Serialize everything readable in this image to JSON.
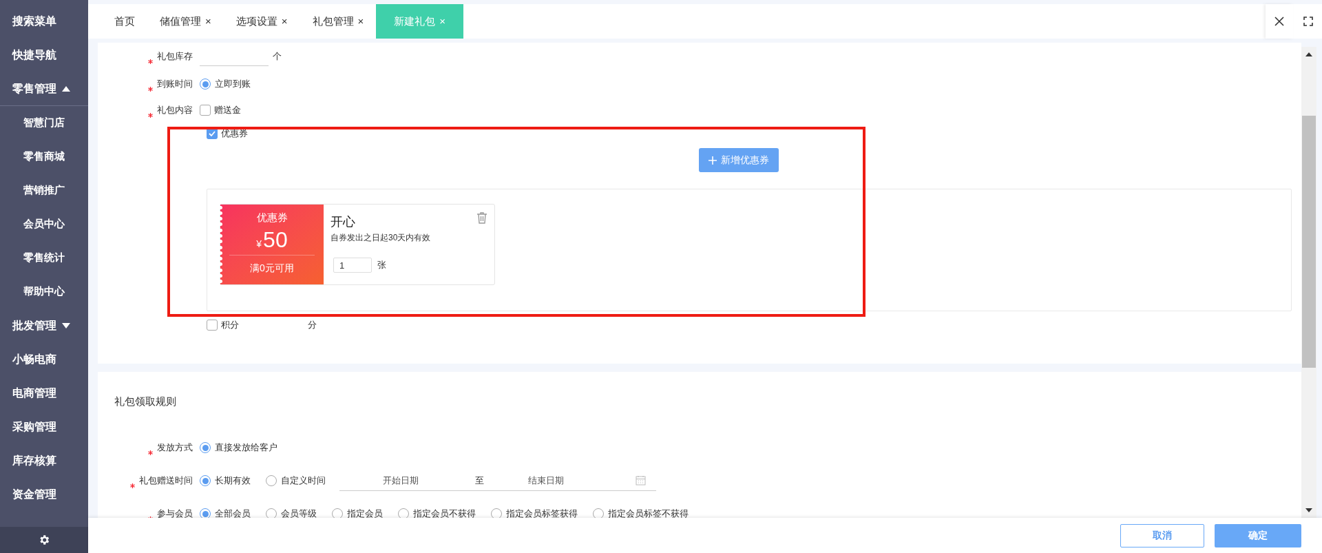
{
  "sidebar": {
    "items": [
      {
        "label": "搜索菜单"
      },
      {
        "label": "快捷导航"
      },
      {
        "label": "零售管理",
        "expanded": true,
        "children": [
          {
            "label": "智慧门店"
          },
          {
            "label": "零售商城"
          },
          {
            "label": "营销推广"
          },
          {
            "label": "会员中心"
          },
          {
            "label": "零售统计"
          },
          {
            "label": "帮助中心"
          }
        ]
      },
      {
        "label": "批发管理",
        "expanded": false
      },
      {
        "label": "小畅电商"
      },
      {
        "label": "电商管理"
      },
      {
        "label": "采购管理"
      },
      {
        "label": "库存核算"
      },
      {
        "label": "资金管理"
      }
    ]
  },
  "tabs": [
    {
      "label": "首页",
      "selected": false
    },
    {
      "label": "储值管理",
      "close": "×",
      "selected": false
    },
    {
      "label": "选项设置",
      "close": "×",
      "selected": false
    },
    {
      "label": "礼包管理",
      "close": "×",
      "selected": false
    },
    {
      "label": "新建礼包",
      "close": "×",
      "selected": true
    }
  ],
  "gift_form": {
    "stock": {
      "label": "礼包库存",
      "required": true,
      "unit": "个"
    },
    "arrival": {
      "label": "到账时间",
      "required": true,
      "options": [
        {
          "label": "立即到账",
          "selected": true
        }
      ]
    },
    "content": {
      "label": "礼包内容",
      "required": true,
      "items": [
        {
          "kind": "gift_money",
          "label": "赠送金",
          "checked": false
        },
        {
          "kind": "coupon",
          "label": "优惠券",
          "checked": true,
          "add_button": "新增优惠券",
          "coupons": [
            {
              "tag": "优惠券",
              "currency": "¥",
              "amount": "50",
              "condition": "满0元可用",
              "name": "开心",
              "validity": "自券发出之日起30天内有效",
              "quantity": "1",
              "unit": "张"
            }
          ]
        },
        {
          "kind": "points",
          "label": "积分",
          "checked": false,
          "unit": "分"
        }
      ]
    }
  },
  "rules": {
    "title": "礼包领取规则",
    "fields": [
      {
        "kind": "radio",
        "label": "发放方式",
        "required": true,
        "options": [
          {
            "label": "直接发放给客户",
            "selected": true
          }
        ]
      },
      {
        "kind": "radio_dates",
        "label": "礼包赠送时间",
        "required": true,
        "options": [
          {
            "label": "长期有效",
            "selected": true
          },
          {
            "label": "自定义时间",
            "selected": false
          }
        ],
        "date_range": {
          "start": "开始日期",
          "separator": "至",
          "end": "结束日期"
        }
      },
      {
        "kind": "radio",
        "label": "参与会员",
        "required": true,
        "options": [
          {
            "label": "全部会员",
            "selected": true
          },
          {
            "label": "会员等级",
            "selected": false
          },
          {
            "label": "指定会员",
            "selected": false
          },
          {
            "label": "指定会员不获得",
            "selected": false
          },
          {
            "label": "指定会员标签获得",
            "selected": false
          },
          {
            "label": "指定会员标签不获得",
            "selected": false
          }
        ]
      }
    ]
  },
  "footer": {
    "buttons": [
      {
        "label": "取消",
        "kind": "secondary"
      },
      {
        "label": "确定",
        "kind": "primary"
      }
    ]
  }
}
